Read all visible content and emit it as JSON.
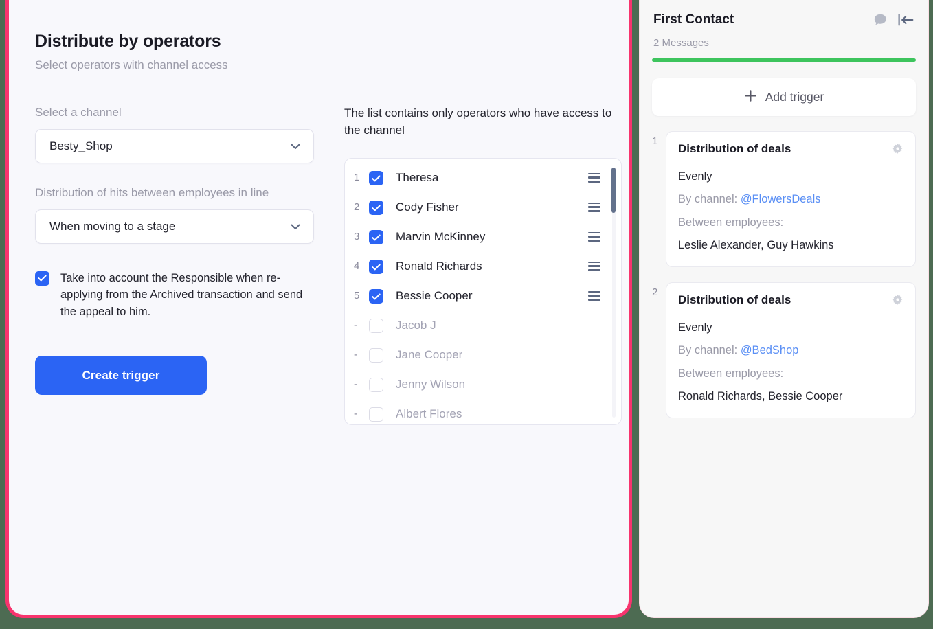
{
  "left": {
    "title": "Distribute by operators",
    "subtitle": "Select operators with channel access",
    "channel_label": "Select a channel",
    "channel_value": "Besty_Shop",
    "distribution_label": "Distribution of hits between employees in line",
    "distribution_value": "When moving to a stage",
    "responsible_checkbox_label": "Take into account the Responsible when re-applying from the Archived transaction and send the appeal to him.",
    "responsible_checked": true,
    "create_button": "Create trigger",
    "list_hint": "The list contains only operators who have access to the channel",
    "operators": [
      {
        "num": "1",
        "name": "Theresa",
        "checked": true
      },
      {
        "num": "2",
        "name": "Cody Fisher",
        "checked": true
      },
      {
        "num": "3",
        "name": "Marvin McKinney",
        "checked": true
      },
      {
        "num": "4",
        "name": "Ronald Richards",
        "checked": true
      },
      {
        "num": "5",
        "name": "Bessie Cooper",
        "checked": true
      },
      {
        "num": "-",
        "name": "Jacob J",
        "checked": false
      },
      {
        "num": "-",
        "name": "Jane Cooper",
        "checked": false
      },
      {
        "num": "-",
        "name": "Jenny Wilson",
        "checked": false
      },
      {
        "num": "-",
        "name": "Albert Flores",
        "checked": false
      }
    ]
  },
  "right": {
    "title": "First Contact",
    "messages": "2 Messages",
    "add_trigger": "Add trigger",
    "triggers": [
      {
        "num": "1",
        "title": "Distribution of deals",
        "mode": "Evenly",
        "channel_prefix": "By channel: ",
        "channel": "@FlowersDeals",
        "employees_label": "Between employees:",
        "employees": "Leslie Alexander, Guy Hawkins"
      },
      {
        "num": "2",
        "title": "Distribution of deals",
        "mode": "Evenly",
        "channel_prefix": "By channel: ",
        "channel": "@BedShop",
        "employees_label": "Between employees:",
        "employees": "Ronald Richards, Bessie Cooper"
      }
    ]
  },
  "colors": {
    "accent_blue": "#2B64F4",
    "panel_border_pink": "#F8346E",
    "progress_green": "#3DC45D",
    "link_blue": "#5A8FF5"
  }
}
